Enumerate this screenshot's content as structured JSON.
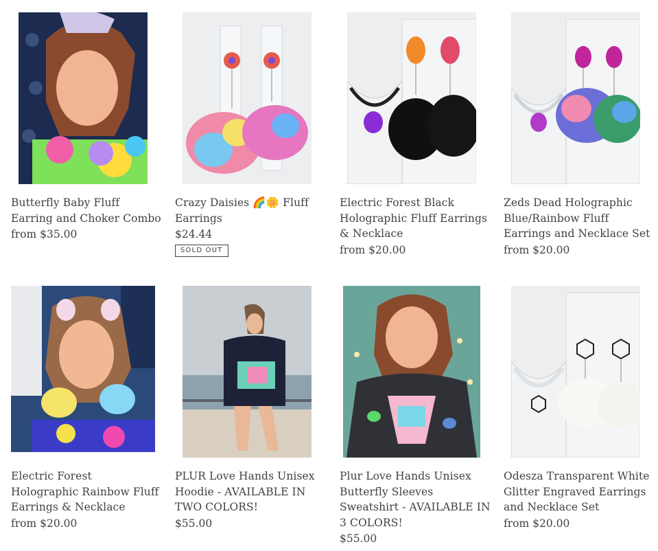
{
  "products": [
    {
      "title": "Butterfly Baby Fluff Earring and Choker Combo",
      "price_prefix": "from",
      "price": "$35.00",
      "image": "woman-with-rainbow-fluff-earrings"
    },
    {
      "title": "Crazy Daisies 🌈🌼 Fluff Earrings",
      "price_prefix": "",
      "price": "$24.44",
      "badge": "SOLD OUT",
      "image": "rainbow-fluff-earrings-on-stand"
    },
    {
      "title": "Electric Forest Black Holographic Fluff Earrings & Necklace",
      "price_prefix": "from",
      "price": "$20.00",
      "image": "black-fluff-earrings-on-stand"
    },
    {
      "title": "Zeds Dead Holographic Blue/Rainbow Fluff Earrings and Necklace Set",
      "price_prefix": "from",
      "price": "$20.00",
      "image": "rainbow-fluff-set-on-stand"
    },
    {
      "title": "Electric Forest Holographic Rainbow Fluff Earrings & Necklace",
      "price_prefix": "from",
      "price": "$20.00",
      "image": "woman-with-fluff-ears"
    },
    {
      "title": "PLUR Love Hands Unisex Hoodie - AVAILABLE IN TWO COLORS!",
      "price_prefix": "",
      "price": "$55.00",
      "image": "woman-in-hoodie-by-ocean"
    },
    {
      "title": "Plur Love Hands Unisex Butterfly Sleeves Sweatshirt - AVAILABLE IN 3 COLORS!",
      "price_prefix": "",
      "price": "$55.00",
      "image": "woman-in-sweatshirt"
    },
    {
      "title": "Odesza Transparent White Glitter Engraved Earrings and Necklace Set",
      "price_prefix": "from",
      "price": "$20.00",
      "image": "white-fluff-set-on-stand"
    }
  ]
}
